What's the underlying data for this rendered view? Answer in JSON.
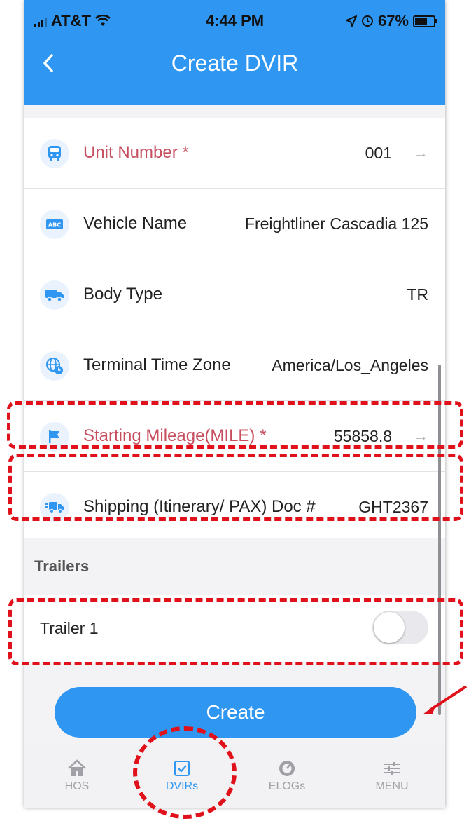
{
  "status_bar": {
    "carrier": "AT&T",
    "time": "4:44 PM",
    "battery": "67%"
  },
  "header": {
    "back_icon": "chevron-left-icon",
    "title": "Create DVIR"
  },
  "fields": [
    {
      "icon": "bus-icon",
      "label": "Unit Number *",
      "value": "001",
      "required": true,
      "has_arrow": true
    },
    {
      "icon": "abc-icon",
      "label": "Vehicle Name",
      "value": "Freightliner Cascadia 125",
      "required": false,
      "has_arrow": false
    },
    {
      "icon": "truck-icon",
      "label": "Body Type",
      "value": "TR",
      "required": false,
      "has_arrow": false
    },
    {
      "icon": "globe-clock-icon",
      "label": "Terminal Time Zone",
      "value": "America/Los_Angeles",
      "required": false,
      "has_arrow": false
    },
    {
      "icon": "flag-icon",
      "label": "Starting Mileage(MILE) *",
      "value": "55858.8",
      "required": true,
      "has_arrow": true
    },
    {
      "icon": "shipping-truck-icon",
      "label": "Shipping (Itinerary/ PAX) Doc #",
      "value": "GHT2367",
      "required": false,
      "has_arrow": false
    }
  ],
  "trailers": {
    "section_label": "Trailers",
    "items": [
      {
        "label": "Trailer 1",
        "enabled": false
      }
    ]
  },
  "create_button": {
    "label": "Create"
  },
  "tab_bar": {
    "tabs": [
      {
        "label": "HOS",
        "icon": "home-icon",
        "active": false
      },
      {
        "label": "DVIRs",
        "icon": "checkbox-icon",
        "active": true
      },
      {
        "label": "ELOGs",
        "icon": "gauge-icon",
        "active": false
      },
      {
        "label": "MENU",
        "icon": "sliders-icon",
        "active": false
      }
    ]
  },
  "colors": {
    "primary": "#2f97f2",
    "required_label": "#c75060",
    "annotation": "#e0111b"
  }
}
